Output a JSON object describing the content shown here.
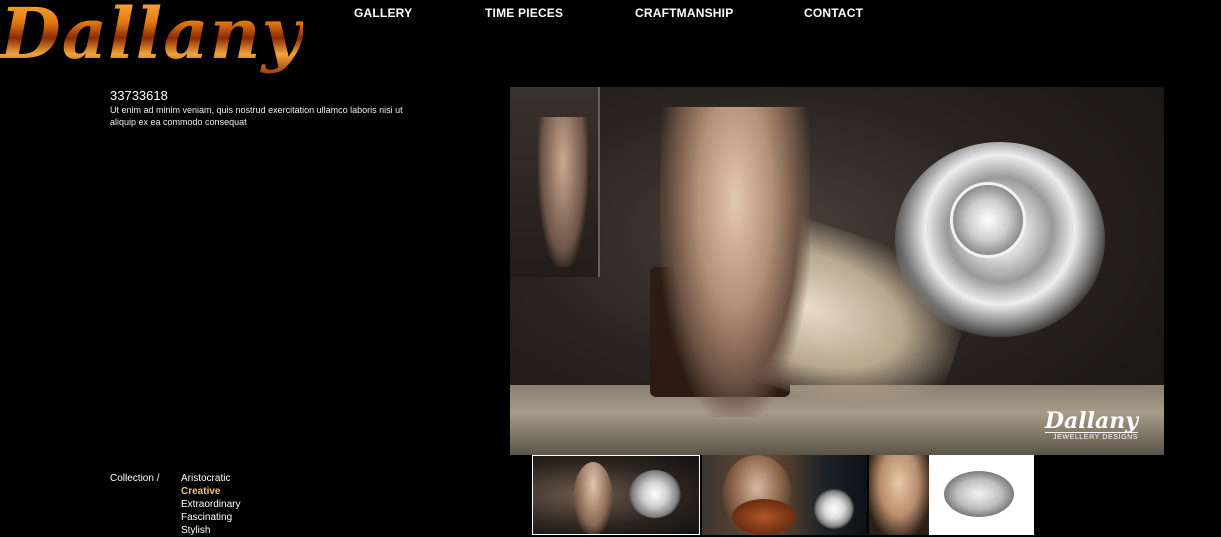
{
  "brand": {
    "logo_text": "Dallany"
  },
  "nav": {
    "items": [
      {
        "label": "GALLERY"
      },
      {
        "label": "TIME PIECES"
      },
      {
        "label": "CRAFTMANSHIP"
      },
      {
        "label": "CONTACT"
      }
    ]
  },
  "info": {
    "id_number": "33733618",
    "description": "Ut enim ad minim veniam, quis nostrud exercitation ullamco laboris nisi ut aliquip ex ea commodo consequat"
  },
  "main_image": {
    "brand_name": "Dallany",
    "brand_sub": "JEWELLERY DESIGNS"
  },
  "collection": {
    "label": "Collection /",
    "items": [
      {
        "label": "Aristocratic"
      },
      {
        "label": "Creative"
      },
      {
        "label": "Extraordinary"
      },
      {
        "label": "Fascinating"
      },
      {
        "label": "Stylish"
      }
    ],
    "active_index": 1,
    "active_color": "#f1c27a"
  }
}
